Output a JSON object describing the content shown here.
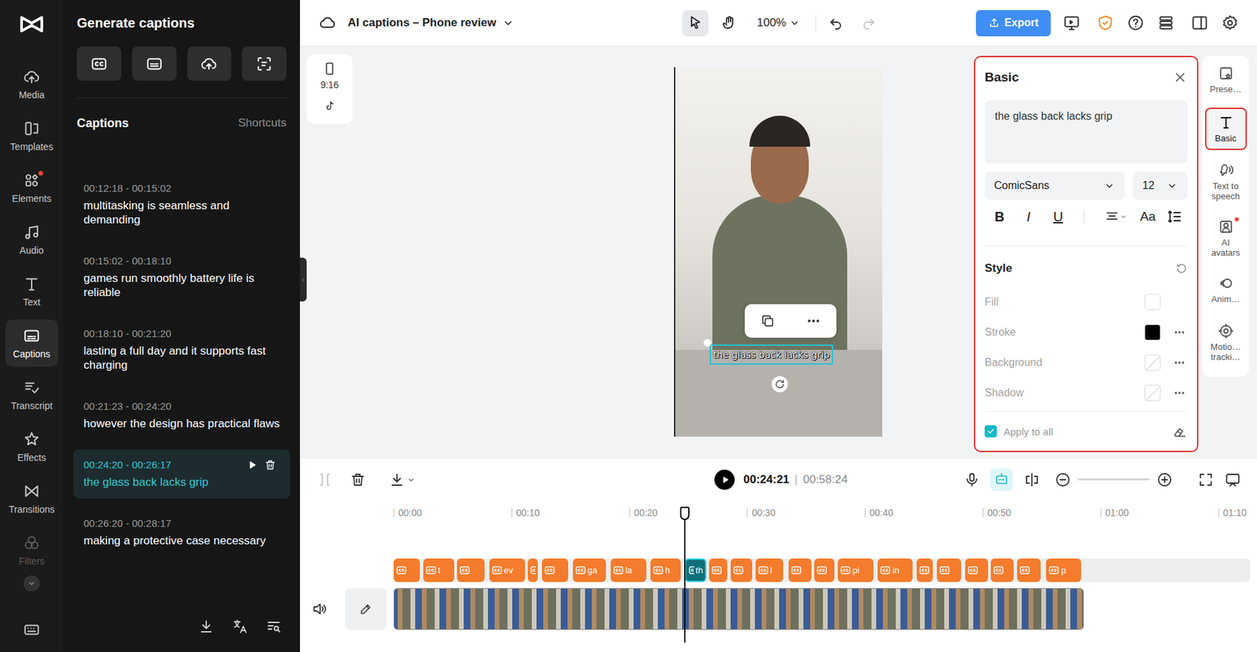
{
  "sidebar": {
    "items": [
      {
        "label": "Media",
        "selected": false,
        "badge": false,
        "disabled": false
      },
      {
        "label": "Templates",
        "selected": false,
        "badge": false,
        "disabled": false
      },
      {
        "label": "Elements",
        "selected": false,
        "badge": true,
        "disabled": false
      },
      {
        "label": "Audio",
        "selected": false,
        "badge": false,
        "disabled": false
      },
      {
        "label": "Text",
        "selected": false,
        "badge": false,
        "disabled": false
      },
      {
        "label": "Captions",
        "selected": true,
        "badge": false,
        "disabled": false
      },
      {
        "label": "Transcript",
        "selected": false,
        "badge": false,
        "disabled": false
      },
      {
        "label": "Effects",
        "selected": false,
        "badge": false,
        "disabled": false
      },
      {
        "label": "Transitions",
        "selected": false,
        "badge": false,
        "disabled": false
      },
      {
        "label": "Filters",
        "selected": false,
        "badge": false,
        "disabled": true
      }
    ]
  },
  "panel": {
    "title": "Generate captions",
    "heading": "Captions",
    "shortcuts": "Shortcuts",
    "items": [
      {
        "time": "00:12:18 - 00:15:02",
        "text": "multitasking is seamless and demanding",
        "selected": false
      },
      {
        "time": "00:15:02 - 00:18:10",
        "text": "games run smoothly battery life is reliable",
        "selected": false
      },
      {
        "time": "00:18:10 - 00:21:20",
        "text": "lasting a full day and it supports fast charging",
        "selected": false
      },
      {
        "time": "00:21:23 - 00:24:20",
        "text": "however the design has practical flaws",
        "selected": false
      },
      {
        "time": "00:24:20 - 00:26:17",
        "text": "the glass back lacks grip",
        "selected": true
      },
      {
        "time": "00:26:20 - 00:28:17",
        "text": "making a protective case necessary",
        "selected": false
      }
    ]
  },
  "project": {
    "title": "AI captions – Phone review"
  },
  "toolbar": {
    "tools": [
      {
        "selected": true
      },
      {
        "selected": false
      }
    ],
    "zoom": "100%",
    "undo_disabled": false,
    "redo_disabled": true,
    "export": "Export"
  },
  "canvas": {
    "ratio": "9:16",
    "caption": "the glass back lacks grip"
  },
  "properties": {
    "title": "Basic",
    "highlighted": true,
    "text": "the glass back lacks grip",
    "font": "ComicSans",
    "size": "12",
    "bold": "B",
    "italic": "I",
    "underline": "U",
    "case": "Aa",
    "style_heading": "Style",
    "rows": [
      {
        "label": "Fill",
        "kind": "solid",
        "color": "#ffffff",
        "more": false
      },
      {
        "label": "Stroke",
        "kind": "solid",
        "color": "#000000",
        "more": true
      },
      {
        "label": "Background",
        "kind": "none",
        "more": true
      },
      {
        "label": "Shadow",
        "kind": "none",
        "more": true
      }
    ],
    "apply_all": {
      "label": "Apply to all",
      "checked": true
    }
  },
  "side_tabs": [
    {
      "label": "Prese…",
      "selected": false,
      "highlighted": false,
      "badge": false
    },
    {
      "label": "Basic",
      "selected": true,
      "highlighted": true,
      "badge": false
    },
    {
      "label": "Text to speech",
      "selected": false,
      "highlighted": false,
      "badge": false
    },
    {
      "label": "AI avatars",
      "selected": false,
      "highlighted": false,
      "badge": true
    },
    {
      "label": "Anim…",
      "selected": false,
      "highlighted": false,
      "badge": false
    },
    {
      "label": "Motio… tracki…",
      "selected": false,
      "highlighted": false,
      "badge": false
    }
  ],
  "timeline": {
    "current": "00:24:21",
    "separator": "|",
    "total": "00:58:24",
    "captions_toggle": {
      "selected": true
    },
    "zoom": {
      "level": 0
    },
    "playhead": 24.7,
    "ruler": [
      "00:00",
      "00:10",
      "00:20",
      "00:30",
      "00:40",
      "00:50",
      "01:00",
      "01:10"
    ],
    "clips": [
      {
        "label": "",
        "start": 0.0,
        "end": 2.3,
        "selected": false
      },
      {
        "label": "t",
        "start": 2.5,
        "end": 5.2,
        "selected": false
      },
      {
        "label": "",
        "start": 5.4,
        "end": 7.8,
        "selected": false
      },
      {
        "label": "ev",
        "start": 8.1,
        "end": 11.2,
        "selected": false
      },
      {
        "label": "",
        "start": 11.4,
        "end": 12.3,
        "selected": false
      },
      {
        "label": "",
        "start": 12.6,
        "end": 14.9,
        "selected": false
      },
      {
        "label": "ga",
        "start": 15.2,
        "end": 18.1,
        "selected": false
      },
      {
        "label": "la",
        "start": 18.4,
        "end": 21.5,
        "selected": false
      },
      {
        "label": "h",
        "start": 21.8,
        "end": 24.4,
        "selected": false
      },
      {
        "label": "th",
        "start": 24.7,
        "end": 26.6,
        "selected": true
      },
      {
        "label": "",
        "start": 26.8,
        "end": 28.4,
        "selected": false
      },
      {
        "label": "",
        "start": 28.6,
        "end": 30.5,
        "selected": false
      },
      {
        "label": "l",
        "start": 30.7,
        "end": 33.1,
        "selected": false
      },
      {
        "label": "",
        "start": 33.5,
        "end": 35.5,
        "selected": false
      },
      {
        "label": "",
        "start": 35.7,
        "end": 37.5,
        "selected": false
      },
      {
        "label": "pi",
        "start": 37.7,
        "end": 40.8,
        "selected": false
      },
      {
        "label": "in",
        "start": 41.1,
        "end": 44.1,
        "selected": false
      },
      {
        "label": "",
        "start": 44.4,
        "end": 45.8,
        "selected": false
      },
      {
        "label": "",
        "start": 46.1,
        "end": 48.2,
        "selected": false
      },
      {
        "label": "",
        "start": 48.5,
        "end": 50.5,
        "selected": false
      },
      {
        "label": "",
        "start": 50.7,
        "end": 52.7,
        "selected": false
      },
      {
        "label": "",
        "start": 52.9,
        "end": 55.0,
        "selected": false
      },
      {
        "label": "p",
        "start": 55.4,
        "end": 58.4,
        "selected": false
      }
    ],
    "video": {
      "start": 0,
      "end": 58.6
    }
  }
}
